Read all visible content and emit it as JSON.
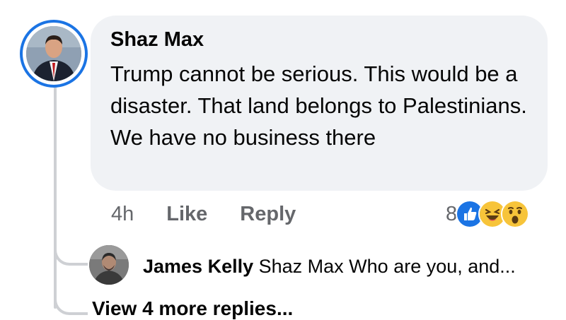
{
  "comment": {
    "author": "Shaz Max",
    "text": "Trump cannot be serious. This would be a disaster. That land belongs to Palestinians. We have no business there",
    "time": "4h",
    "like_label": "Like",
    "reply_label": "Reply",
    "reaction_count": "8",
    "reactions": [
      "like-icon",
      "haha-icon",
      "wow-icon"
    ]
  },
  "reply": {
    "author": "James Kelly",
    "text": "Shaz Max Who are you, and..."
  },
  "view_more_label": "View 4 more replies...",
  "colors": {
    "accent": "#1b74e4",
    "bubble": "#f0f2f5",
    "secondary_text": "#65676b",
    "thread_line": "#ced0d4"
  }
}
